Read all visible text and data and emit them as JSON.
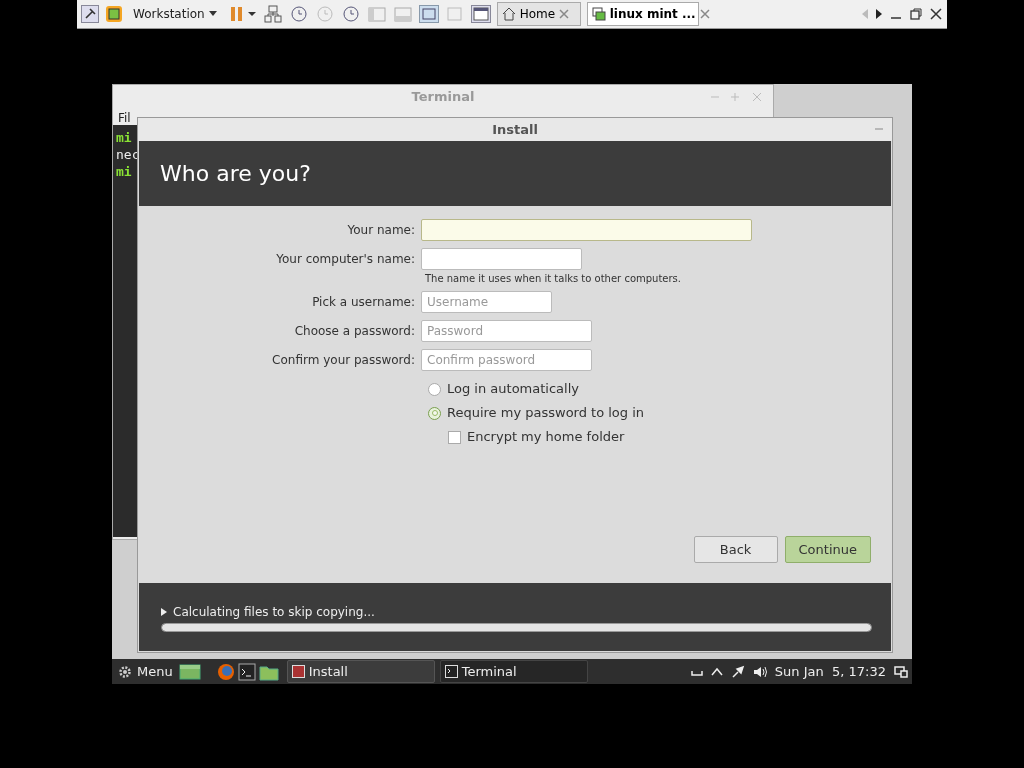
{
  "host_toolbar": {
    "vm_menu": "Workstation",
    "tabs": [
      {
        "label": "Home",
        "selected": false
      },
      {
        "label": "linux mint ...",
        "selected": true
      }
    ]
  },
  "terminal_window": {
    "title": "Terminal",
    "menu": [
      "Fil"
    ],
    "lines": [
      {
        "text": "mi",
        "kind": "prompt"
      },
      {
        "text": "nec",
        "kind": "output"
      },
      {
        "text": "mi",
        "kind": "prompt"
      }
    ]
  },
  "install_window": {
    "title": "Install",
    "heading": "Who are you?",
    "fields": [
      {
        "label": "Your name:",
        "focused": true
      },
      {
        "label": "Your computer's name:",
        "focused": false,
        "hint": "The name it uses when it talks to other computers."
      },
      {
        "label": "Pick a username:",
        "placeholder": "Username",
        "focused": false
      },
      {
        "label": "Choose a password:",
        "placeholder": "Password",
        "focused": false
      },
      {
        "label": "Confirm your password:",
        "placeholder": "Confirm password",
        "focused": false
      }
    ],
    "login_options": [
      {
        "label": "Log in automatically",
        "selected": false
      },
      {
        "label": "Require my password to log in",
        "selected": true
      }
    ],
    "encrypt": {
      "label": "Encrypt my home folder",
      "checked": false
    },
    "buttons": [
      {
        "label": "Back",
        "kind": "normal"
      },
      {
        "label": "Continue",
        "kind": "primary"
      }
    ],
    "progress": {
      "text": "Calculating files to skip copying...",
      "level": 1
    }
  },
  "taskbar": {
    "menu": "Menu",
    "windows": [
      {
        "label": "Install",
        "selected": true
      },
      {
        "label": "Terminal",
        "selected": false
      }
    ],
    "clock": "Sun Jan  5, 17:32"
  }
}
